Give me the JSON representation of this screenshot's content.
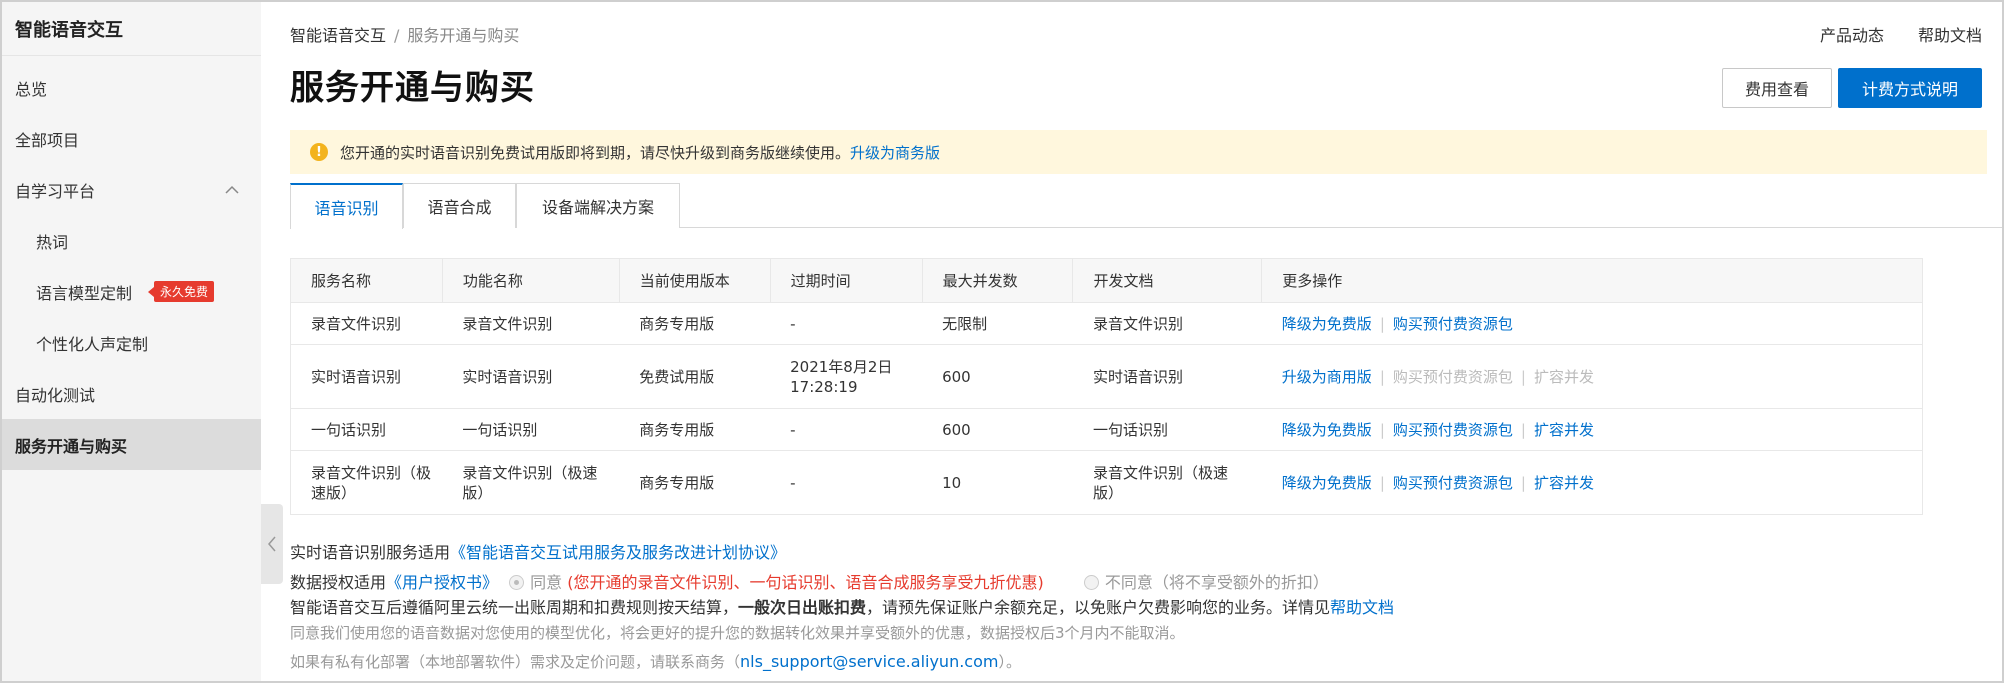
{
  "sidebar": {
    "title": "智能语音交互",
    "items": [
      {
        "label": "总览"
      },
      {
        "label": "全部项目"
      },
      {
        "label": "自学习平台"
      },
      {
        "label": "热词"
      },
      {
        "label": "语言模型定制",
        "badge": "永久免费"
      },
      {
        "label": "个性化人声定制"
      },
      {
        "label": "自动化测试"
      },
      {
        "label": "服务开通与购买"
      }
    ]
  },
  "header": {
    "breadcrumb_root": "智能语音交互",
    "breadcrumb_sep": "/",
    "breadcrumb_current": "服务开通与购买",
    "links": [
      "产品动态",
      "帮助文档"
    ],
    "title": "服务开通与购买",
    "btn_fee": "费用查看",
    "btn_billing": "计费方式说明"
  },
  "notice": {
    "icon": "!",
    "text": "您开通的实时语音识别免费试用版即将到期，请尽快升级到商务版继续使用。",
    "link": "升级为商务版"
  },
  "tabs": [
    "语音识别",
    "语音合成",
    "设备端解决方案"
  ],
  "table": {
    "headers": [
      "服务名称",
      "功能名称",
      "当前使用版本",
      "过期时间",
      "最大并发数",
      "开发文档",
      "更多操作"
    ],
    "rows": [
      {
        "name": "录音文件识别",
        "feature": "录音文件识别",
        "version": "商务专用版",
        "expire": "-",
        "concurrency": "无限制",
        "doc": "录音文件识别",
        "op1": "降级为免费版",
        "op2": "购买预付费资源包",
        "op3": ""
      },
      {
        "name": "实时语音识别",
        "feature": "实时语音识别",
        "version": "免费试用版",
        "expire": "2021年8月2日 17:28:19",
        "concurrency": "600",
        "doc": "实时语音识别",
        "op1": "升级为商用版",
        "op2": "购买预付费资源包",
        "op3": "扩容并发"
      },
      {
        "name": "一句话识别",
        "feature": "一句话识别",
        "version": "商务专用版",
        "expire": "-",
        "concurrency": "600",
        "doc": "一句话识别",
        "op1": "降级为免费版",
        "op2": "购买预付费资源包",
        "op3": "扩容并发"
      },
      {
        "name": "录音文件识别（极速版）",
        "feature": "录音文件识别（极速版）",
        "version": "商务专用版",
        "expire": "-",
        "concurrency": "10",
        "doc": "录音文件识别（极速版）",
        "op1": "降级为免费版",
        "op2": "购买预付费资源包",
        "op3": "扩容并发"
      }
    ]
  },
  "footer": {
    "line1_prefix": "实时语音识别服务适用",
    "line1_link": "《智能语音交互试用服务及服务改进计划协议》",
    "line2_prefix": "数据授权适用",
    "line2_link": "《用户授权书》",
    "agree_label": "同意",
    "agree_note": "(您开通的录音文件识别、一句话识别、语音合成服务享受九折优惠)",
    "disagree_label": "不同意（将不享受额外的折扣）",
    "line3_a": "智能语音交互后遵循阿里云统一出账周期和扣费规则按天结算，",
    "line3_bold": "一般次日出账扣费",
    "line3_b": "，请预先保证账户余额充足，以免账户欠费影响您的业务。详情见",
    "line3_link": "帮助文档",
    "line4": "同意我们使用您的语音数据对您使用的模型优化，将会更好的提升您的数据转化效果并享受额外的优惠，数据授权后3个月内不能取消。",
    "line5_a": "如果有私有化部署（本地部署软件）需求及定价问题，请联系商务（",
    "line5_email": "nls_support@service.aliyun.com",
    "line5_b": "）。"
  }
}
